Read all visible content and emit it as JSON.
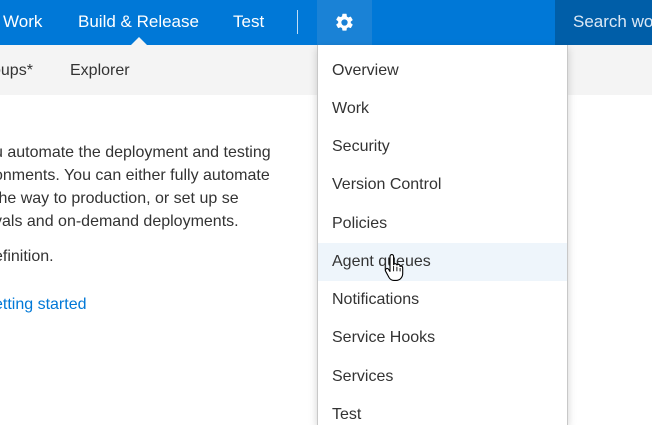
{
  "topnav": {
    "items": [
      "Work",
      "Build & Release",
      "Test"
    ],
    "settings_icon": "gear-icon",
    "search_placeholder": "Search wo"
  },
  "subnav": {
    "items": [
      "oups*",
      "Explorer"
    ]
  },
  "content": {
    "paragraph_lines": [
      "u automate the deployment and testing",
      "onments. You can either fully automate",
      " the way to production, or set up se",
      "vals and on-demand deployments."
    ],
    "note": "efinition.",
    "link": "etting started"
  },
  "settings_menu": {
    "items": [
      "Overview",
      "Work",
      "Security",
      "Version Control",
      "Policies",
      "Agent queues",
      "Notifications",
      "Service Hooks",
      "Services",
      "Test"
    ],
    "hovered_item": "Agent queues"
  },
  "colors": {
    "topbar": "#0078d7",
    "search_box": "#005ea8",
    "subbar": "#f4f4f4",
    "link": "#0078d7",
    "menu_hover": "#eef5fb"
  },
  "cursor": "hand-pointer-icon"
}
